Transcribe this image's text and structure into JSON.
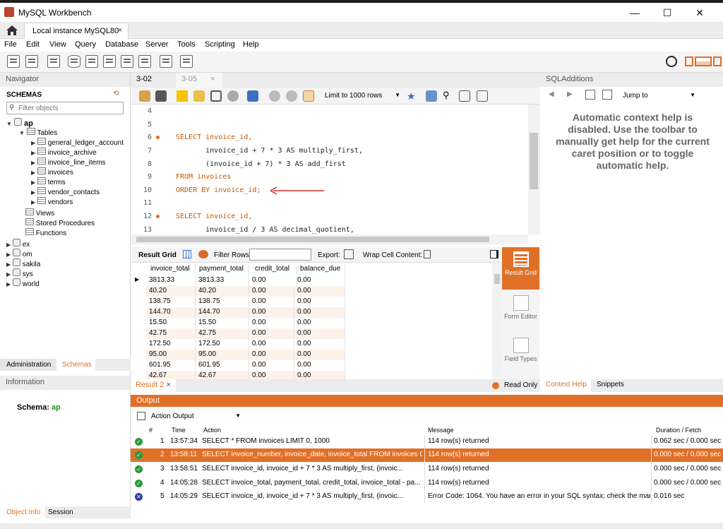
{
  "window": {
    "title": "MySQL Workbench",
    "minimize": "—",
    "maximize": "☐",
    "close": "✕"
  },
  "tabs": {
    "connection": "Local instance MySQL80",
    "close": "×"
  },
  "menu": [
    "File",
    "Edit",
    "View",
    "Query",
    "Database",
    "Server",
    "Tools",
    "Scripting",
    "Help"
  ],
  "navigator": {
    "header": "Navigator",
    "schemas_label": "SCHEMAS",
    "filter_placeholder": "Filter objects",
    "active_schema": "ap",
    "tables_label": "Tables",
    "tables": [
      "general_ledger_account",
      "invoice_archive",
      "invoice_line_items",
      "invoices",
      "terms",
      "vendor_contacts",
      "vendors"
    ],
    "views": "Views",
    "procedures": "Stored Procedures",
    "functions": "Functions",
    "other_schemas": [
      "ex",
      "om",
      "sakila",
      "sys",
      "world"
    ],
    "bottom_tabs": [
      "Administration",
      "Schemas"
    ]
  },
  "information": {
    "header": "Information",
    "schema_label": "Schema:",
    "schema_value": "ap",
    "bottom_tabs": [
      "Object Info",
      "Session"
    ]
  },
  "editor": {
    "tabs": [
      "3-02",
      "3-05"
    ],
    "tab_close": "×",
    "limit": "Limit to 1000 rows",
    "lines": [
      {
        "n": "4",
        "code": ""
      },
      {
        "n": "5",
        "code": ""
      },
      {
        "n": "6",
        "code": "SELECT invoice_id,",
        "mark": true
      },
      {
        "n": "7",
        "code": "       invoice_id + 7 * 3 AS multiply_first,"
      },
      {
        "n": "8",
        "code": "       (invoice_id + 7) * 3 AS add_first"
      },
      {
        "n": "9",
        "code": "FROM invoices"
      },
      {
        "n": "10",
        "code": "ORDER BY invoice_id;"
      },
      {
        "n": "11",
        "code": ""
      },
      {
        "n": "12",
        "code": "SELECT invoice_id,",
        "mark": true
      },
      {
        "n": "13",
        "code": "       invoice_id / 3 AS decimal_quotient,"
      }
    ],
    "accent": "#e07028"
  },
  "result_toolbar": {
    "result_grid": "Result Grid",
    "filter_rows": "Filter Rows:",
    "export": "Export:",
    "wrap": "Wrap Cell Content:"
  },
  "grid": {
    "columns": [
      "invoice_total",
      "payment_total",
      "credit_total",
      "balance_due"
    ],
    "rows": [
      [
        "3813.33",
        "3813.33",
        "0.00",
        "0.00"
      ],
      [
        "40.20",
        "40.20",
        "0.00",
        "0.00"
      ],
      [
        "138.75",
        "138.75",
        "0.00",
        "0.00"
      ],
      [
        "144.70",
        "144.70",
        "0.00",
        "0.00"
      ],
      [
        "15.50",
        "15.50",
        "0.00",
        "0.00"
      ],
      [
        "42.75",
        "42.75",
        "0.00",
        "0.00"
      ],
      [
        "172.50",
        "172.50",
        "0.00",
        "0.00"
      ],
      [
        "95.00",
        "95.00",
        "0.00",
        "0.00"
      ],
      [
        "601.95",
        "601.95",
        "0.00",
        "0.00"
      ],
      [
        "42.67",
        "42.67",
        "0.00",
        "0.00"
      ]
    ]
  },
  "side_panel": {
    "result_grid": "Result Grid",
    "form_editor": "Form Editor",
    "field_types": "Field Types"
  },
  "result_tabs": {
    "result": "Result 2",
    "close": "×",
    "read_only": "Read Only"
  },
  "sql_additions": {
    "header": "SQLAdditions",
    "jump_to": "Jump to",
    "help_text": "Automatic context help is disabled. Use the toolbar to manually get help for the current caret position or to toggle automatic help.",
    "tabs": [
      "Context Help",
      "Snippets"
    ]
  },
  "output": {
    "header": "Output",
    "selector": "Action Output",
    "columns": {
      "num": "#",
      "time": "Time",
      "action": "Action",
      "message": "Message",
      "duration": "Duration / Fetch"
    },
    "rows": [
      {
        "num": "1",
        "time": "13:57:34",
        "action": "SELECT * FROM invoices LIMIT 0, 1000",
        "message": "114 row(s) returned",
        "duration": "0.062 sec / 0.000 sec",
        "status": "ok"
      },
      {
        "num": "2",
        "time": "13:58:11",
        "action": "SELECT invoice_number, invoice_date, invoice_total FROM invoices O...",
        "message": "114 row(s) returned",
        "duration": "0.000 sec / 0.000 sec",
        "status": "ok"
      },
      {
        "num": "3",
        "time": "13:58:51",
        "action": "SELECT invoice_id,          invoice_id + 7 * 3 AS multiply_first,          (invoic...",
        "message": "114 row(s) returned",
        "duration": "0.000 sec / 0.000 sec",
        "status": "ok"
      },
      {
        "num": "4",
        "time": "14:05:28",
        "action": "SELECT invoice_total, payment_total, credit_total,          invoice_total - pa...",
        "message": "114 row(s) returned",
        "duration": "0.000 sec / 0.000 sec",
        "status": "ok"
      },
      {
        "num": "5",
        "time": "14:05:29",
        "action": "SELECT invoice_id,          invoice_id + 7 * 3 AS multiply_first,          (invoic...",
        "message": "Error Code: 1064. You have an error in your SQL syntax; check the man...",
        "duration": "0.016 sec",
        "status": "error"
      }
    ]
  }
}
